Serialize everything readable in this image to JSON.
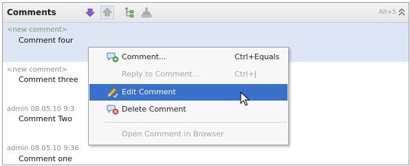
{
  "panel": {
    "title": "Comments",
    "shortcut": "Alt+5",
    "colors": {
      "header_bg": "#ececec",
      "selected_bg": "#dce6f4",
      "menu_highlight": "#3b6fcc"
    }
  },
  "toolbar": {
    "icons": [
      "arrow-down-icon",
      "arrow-up-icon",
      "tree-structure-icon",
      "stamp-icon"
    ]
  },
  "comments": [
    {
      "meta": "<new comment>",
      "text": "Comment four"
    },
    {
      "meta": "<new comment>",
      "text": "Comment three"
    },
    {
      "meta": "admin   08.05.10 9:3",
      "text": "Comment Two"
    },
    {
      "meta": "admin   08.05.10 9:36",
      "text": "Comment one"
    }
  ],
  "context_menu": {
    "items": [
      {
        "label": "Comment...",
        "shortcut": "Ctrl+Equals",
        "icon": "new-comment-icon",
        "state": "enabled"
      },
      {
        "label": "Reply to Comment...",
        "shortcut": "Ctrl+J",
        "icon": "",
        "state": "disabled"
      },
      {
        "label": "Edit Comment",
        "shortcut": "",
        "icon": "edit-pencil-icon",
        "state": "highlighted"
      },
      {
        "label": "Delete Comment",
        "shortcut": "",
        "icon": "delete-comment-icon",
        "state": "enabled"
      },
      {
        "label": "Open Comment in Browser",
        "shortcut": "",
        "icon": "",
        "state": "disabled"
      }
    ]
  }
}
